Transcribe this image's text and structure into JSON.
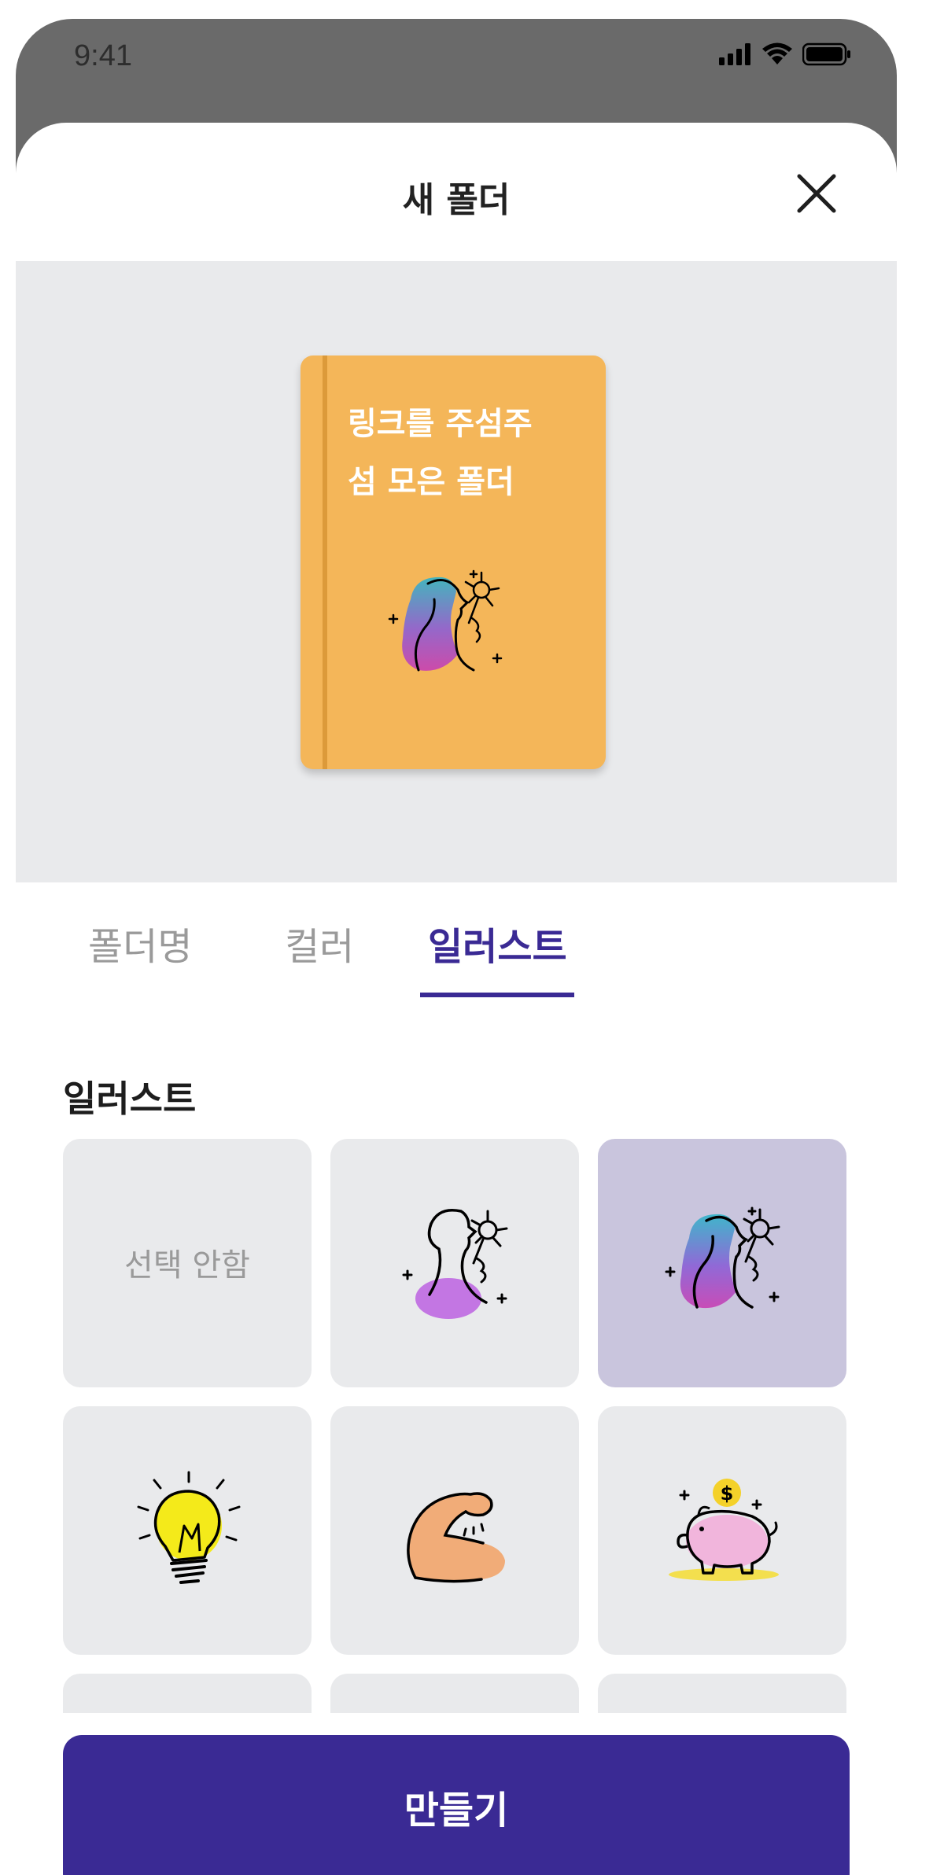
{
  "status_bar": {
    "time": "9:41",
    "icons": [
      "signal-icon",
      "wifi-icon",
      "battery-icon"
    ]
  },
  "sheet": {
    "title": "새 폴더",
    "close_icon": "close-icon"
  },
  "preview": {
    "folder_title_line1": "링크를 주섬주",
    "folder_title_line2": "섬 모은 폴더",
    "folder_color": "#f4b659",
    "folder_illustration": "woman-smelling-flower-gradient"
  },
  "tabs": [
    {
      "label": "폴더명",
      "active": false
    },
    {
      "label": "컬러",
      "active": false
    },
    {
      "label": "일러스트",
      "active": true
    }
  ],
  "illustration_section": {
    "title": "일러스트",
    "items": [
      {
        "label": "선택 안함",
        "icon": null,
        "selected": false
      },
      {
        "label": "",
        "icon": "woman-flower-purple-icon",
        "selected": false
      },
      {
        "label": "",
        "icon": "woman-flower-gradient-icon",
        "selected": true
      },
      {
        "label": "",
        "icon": "lightbulb-icon",
        "selected": false
      },
      {
        "label": "",
        "icon": "flexed-arm-icon",
        "selected": false
      },
      {
        "label": "",
        "icon": "piggy-bank-icon",
        "selected": false
      },
      {
        "label": "",
        "icon": null,
        "selected": false
      },
      {
        "label": "",
        "icon": null,
        "selected": false
      },
      {
        "label": "",
        "icon": null,
        "selected": false
      }
    ]
  },
  "create_button": {
    "label": "만들기"
  },
  "colors": {
    "accent": "#3a2a94",
    "folder": "#f4b659",
    "tile_bg": "#e9eaec",
    "tile_selected_bg": "#c9c5dd"
  }
}
